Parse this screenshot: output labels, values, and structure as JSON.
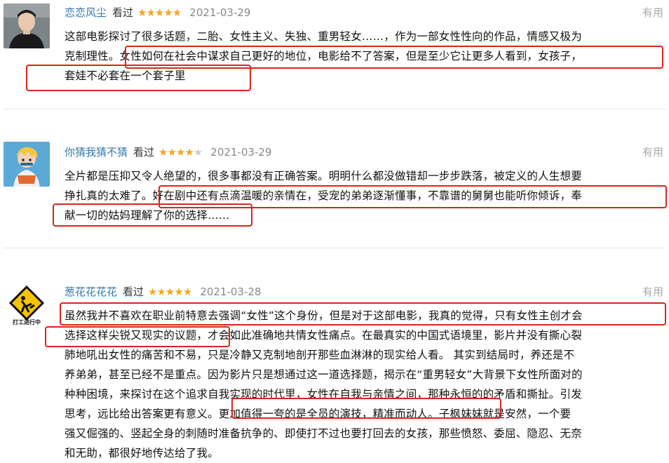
{
  "reviews": [
    {
      "user": "恋恋风尘",
      "status": "看过",
      "rating": 5,
      "stars_text": "★★★★★",
      "stars_off": "",
      "date": "2021-03-29",
      "useful": "有用",
      "lines": [
        "这部电影探讨了很多话题，二胎、女性主义、失独、重男轻女……，作为一部女性性向的作品，情感又极为",
        "克制理性。女性如何在社会中谋求自己更好的地位，电影给不了答案，但是至少它让更多人看到，女孩子，",
        "套娃不必套在一个套子里"
      ]
    },
    {
      "user": "你猜我猜不猜",
      "status": "看过",
      "rating": 4,
      "stars_text": "★★★★",
      "stars_off": "★",
      "date": "2021-03-29",
      "useful": "有用",
      "lines": [
        "全片都是压抑又令人绝望的，很多事都没有正确答案。明明什么都没做错却一步步跌落，被定义的人生想要",
        "挣扎真的太难了。好在剧中还有点滴温暖的亲情在，受宠的弟弟逐渐懂事，不靠谱的舅舅也能听你倾诉，奉",
        "献一切的姑妈理解了你的选择……"
      ]
    },
    {
      "user": "葱花花花花",
      "status": "看过",
      "rating": 5,
      "stars_text": "★★★★★",
      "stars_off": "",
      "date": "2021-03-28",
      "useful": "有用",
      "avatar_text": "打工进行中",
      "lines": [
        "虽然我并不喜欢在职业前特意去强调“女性”这个身份，但是对于这部电影，我真的觉得，只有女性主创才会",
        "选择这样尖锐又现实的议题，才会如此准确地共情女性痛点。在最真实的中国式语境里，影片并没有撕心裂",
        "肺地吼出女性的痛苦和不易，只是冷静又克制地剖开那些血淋淋的现实给人看。 其实到结局时，养还是不",
        "养弟弟，甚至已经不是重点。因为影片只是想通过这一道选择题，揭示在“重男轻女”大背景下女性所面对的",
        "种种困境，来探讨在这个追求自我实现的时代里，女性在自我与亲情之间，那种永恒的的矛盾和撕扯。引发",
        "思考，远比给出答案更有意义。更加值得一夸的是全员的演技，精准而动人。子枫妹妹就是安然，一个要",
        "强又倔强的、竖起全身的刺随时准备抗争的、即使打不过也要打回去的女孩，那些愤怒、委屈、隐忍、无奈",
        "和无助，都很好地传达给了我。"
      ]
    }
  ],
  "colors": {
    "username": "#3377aa",
    "star": "#f5a623",
    "highlight": "#d9251d"
  }
}
